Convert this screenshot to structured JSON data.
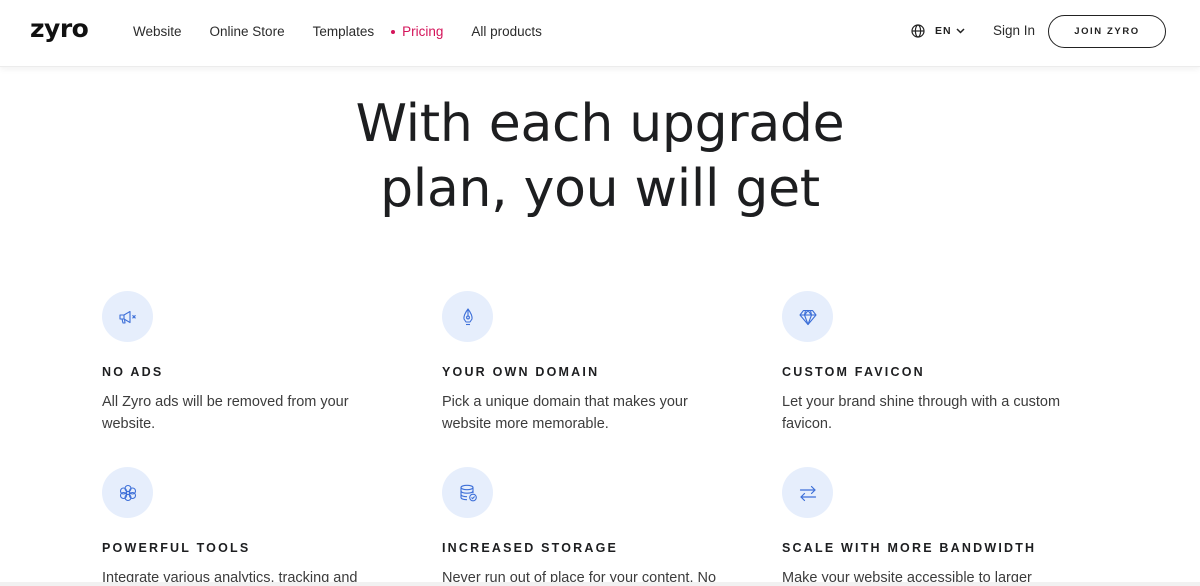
{
  "header": {
    "logo": "zyro",
    "nav": [
      {
        "label": "Website",
        "active": false
      },
      {
        "label": "Online Store",
        "active": false
      },
      {
        "label": "Templates",
        "active": false
      },
      {
        "label": "Pricing",
        "active": true
      },
      {
        "label": "All products",
        "active": false
      }
    ],
    "language": "EN",
    "sign_in": "Sign In",
    "join_button": "JOIN ZYRO"
  },
  "hero": {
    "line1": "With each upgrade",
    "line2": "plan, you will get"
  },
  "features": [
    {
      "icon": "megaphone-mute-icon",
      "title": "NO ADS",
      "description": "All Zyro ads will be removed from your website."
    },
    {
      "icon": "pen-nib-icon",
      "title": "YOUR OWN DOMAIN",
      "description": "Pick a unique domain that makes your website more memorable."
    },
    {
      "icon": "diamond-icon",
      "title": "CUSTOM FAVICON",
      "description": "Let your brand shine through with a custom favicon."
    },
    {
      "icon": "flower-icon",
      "title": "POWERFUL TOOLS",
      "description": "Integrate various analytics, tracking and"
    },
    {
      "icon": "database-check-icon",
      "title": "INCREASED STORAGE",
      "description": "Never run out of place for your content. No"
    },
    {
      "icon": "swap-arrows-icon",
      "title": "SCALE WITH MORE BANDWIDTH",
      "description": "Make your website accessible to larger"
    }
  ],
  "colors": {
    "accent": "#d4145a",
    "icon_bg": "#e6eefc",
    "icon_stroke": "#3d6fd8"
  }
}
